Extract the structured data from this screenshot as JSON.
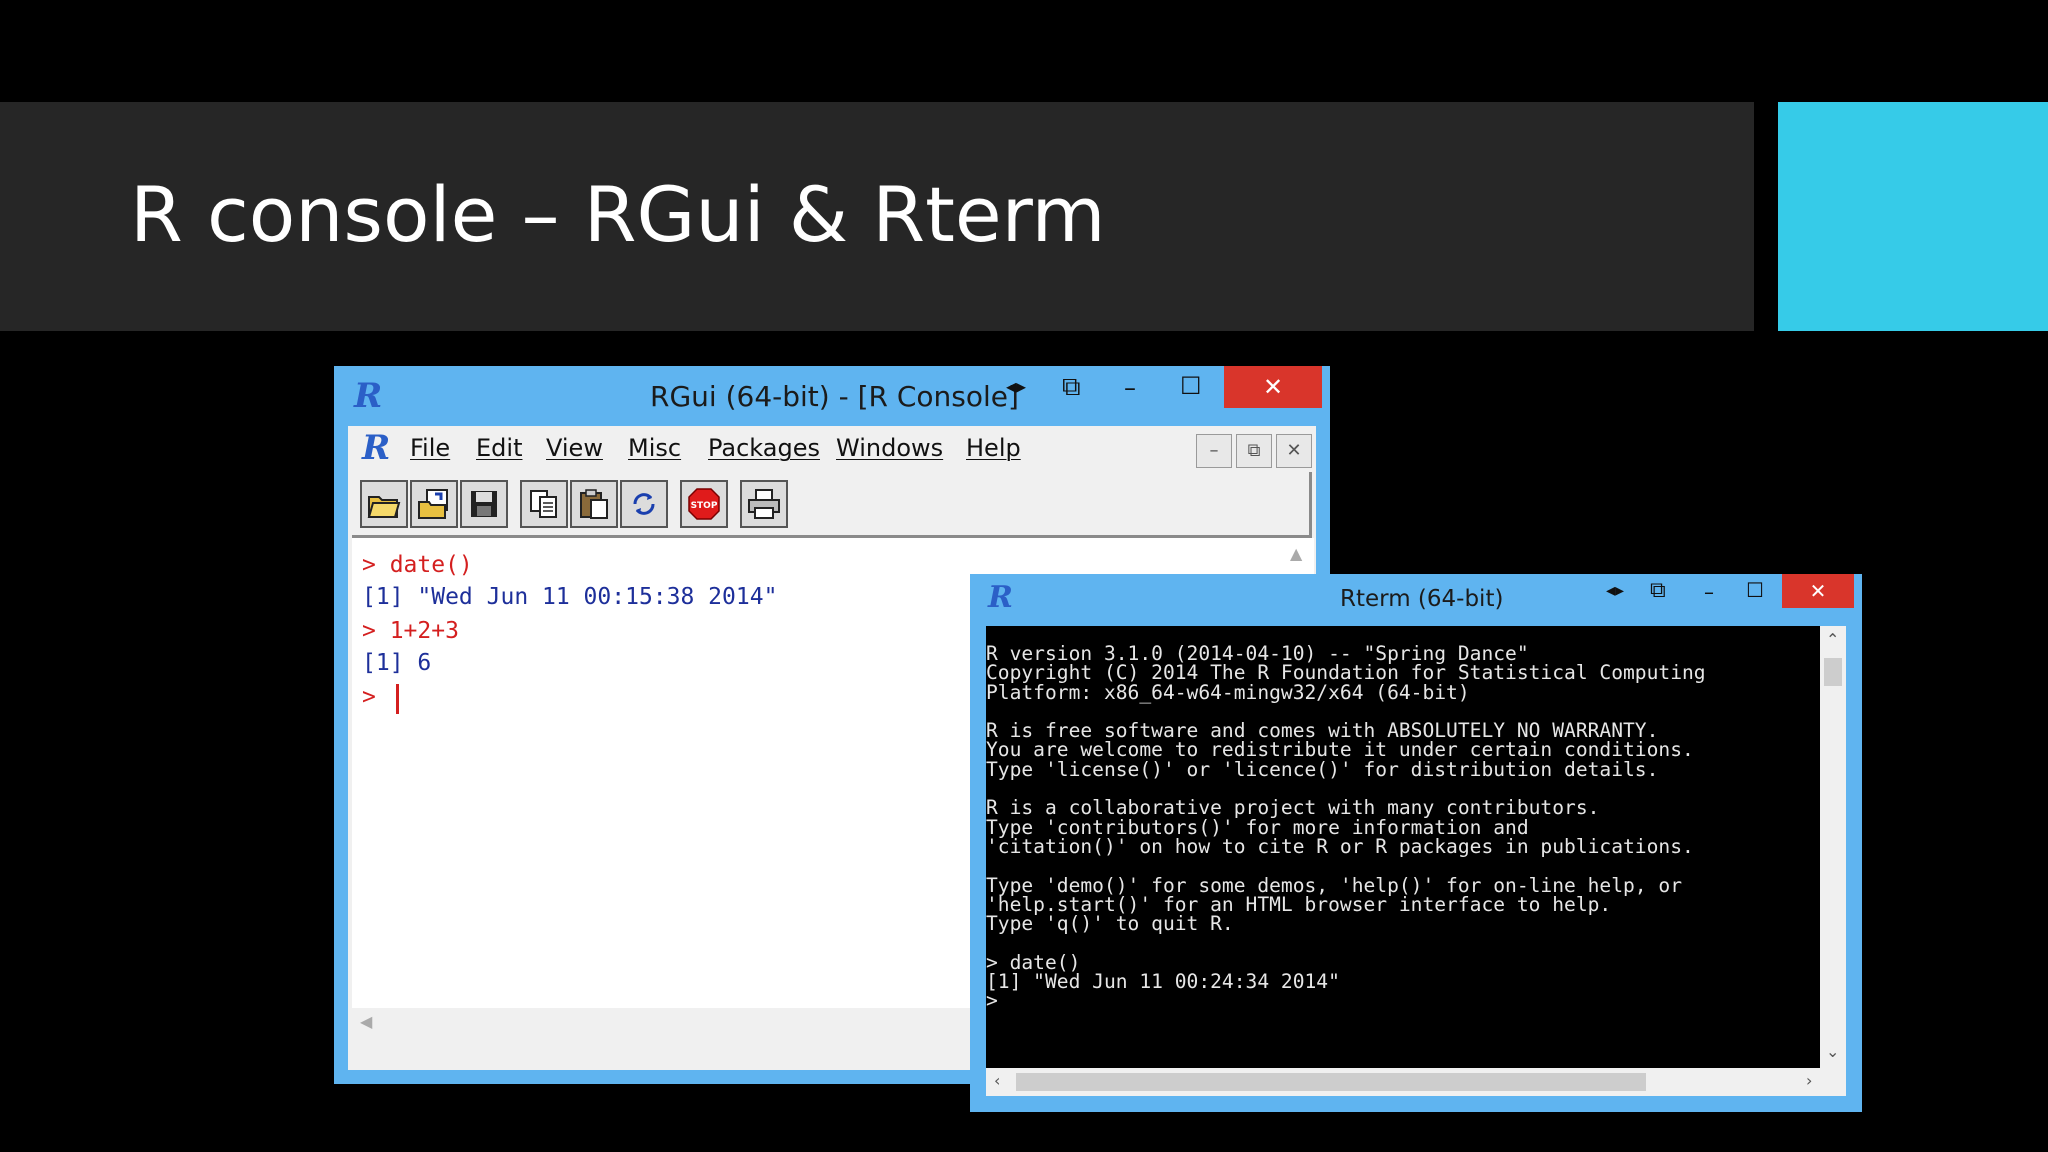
{
  "slide": {
    "title": "R console – RGui & Rterm",
    "band_color": "#262626",
    "accent_color": "#36cbe8"
  },
  "rgui": {
    "window_title": "RGui (64-bit) - [R Console]",
    "logo": "R",
    "menu": [
      "File",
      "Edit",
      "View",
      "Misc",
      "Packages",
      "Windows",
      "Help"
    ],
    "toolbar_icons": [
      "open-script-icon",
      "load-workspace-icon",
      "save-icon",
      "copy-icon",
      "paste-icon",
      "copy-paste-icon",
      "stop-icon",
      "print-icon"
    ],
    "stop_label": "STOP",
    "console": [
      {
        "type": "command",
        "text": "> date()"
      },
      {
        "type": "output",
        "text": "[1] \"Wed Jun 11 00:15:38 2014\""
      },
      {
        "type": "command",
        "text": "> 1+2+3"
      },
      {
        "type": "output",
        "text": "[1] 6"
      },
      {
        "type": "command",
        "text": "> "
      }
    ],
    "command_color": "#d41f1f",
    "output_color": "#1d2f9a"
  },
  "rterm": {
    "window_title": "Rterm (64-bit)",
    "logo": "R",
    "lines": [
      "R version 3.1.0 (2014-04-10) -- \"Spring Dance\"",
      "Copyright (C) 2014 The R Foundation for Statistical Computing",
      "Platform: x86_64-w64-mingw32/x64 (64-bit)",
      "",
      "R is free software and comes with ABSOLUTELY NO WARRANTY.",
      "You are welcome to redistribute it under certain conditions.",
      "Type 'license()' or 'licence()' for distribution details.",
      "",
      "R is a collaborative project with many contributors.",
      "Type 'contributors()' for more information and",
      "'citation()' on how to cite R or R packages in publications.",
      "",
      "Type 'demo()' for some demos, 'help()' for on-line help, or",
      "'help.start()' for an HTML browser interface to help.",
      "Type 'q()' to quit R.",
      "",
      "> date()",
      "[1] \"Wed Jun 11 00:24:34 2014\"",
      ">"
    ]
  },
  "window_controls": {
    "minimize": "–",
    "maximize": "☐",
    "close": "✕",
    "snap": "◂▸",
    "restore": "⧉"
  }
}
